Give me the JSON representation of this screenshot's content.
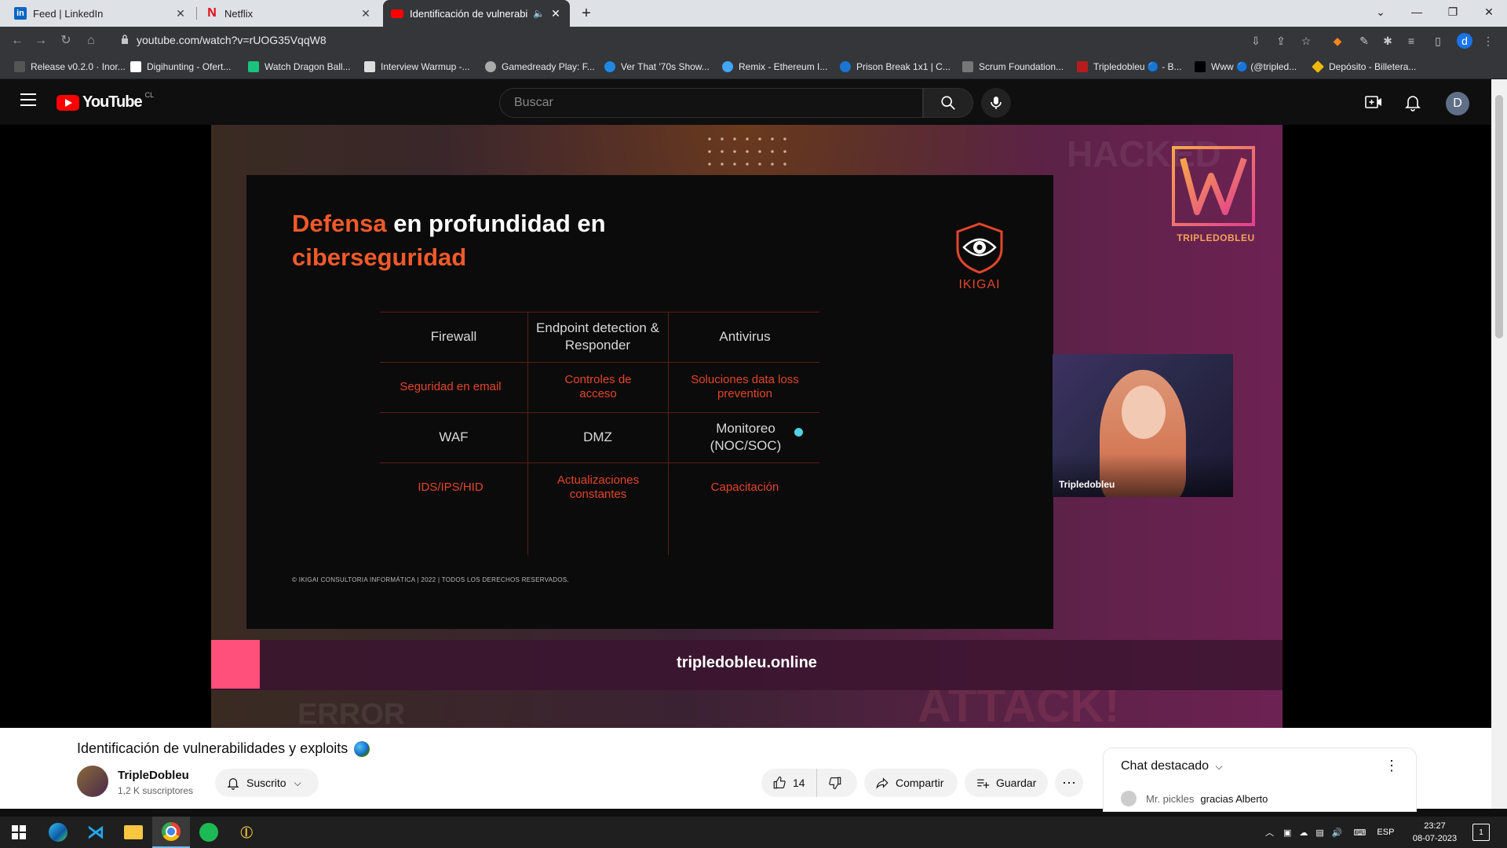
{
  "browser": {
    "tabs": [
      {
        "title": "Feed | LinkedIn",
        "favicon": "linkedin-icon",
        "color": "#0a66c2"
      },
      {
        "title": "Netflix",
        "favicon": "netflix-icon",
        "color": "#e50914"
      },
      {
        "title": "Identificación de vulnerabilidades y exploits",
        "favicon": "youtube-icon",
        "color": "#ff0000",
        "active": true
      }
    ],
    "url": "youtube.com/watch?v=rUOG35VqqW8",
    "bookmarks": [
      {
        "label": "Release v0.2.0 · Inor...",
        "color": "#555"
      },
      {
        "label": "Digihunting - Ofert...",
        "color": "#fff"
      },
      {
        "label": "Watch Dragon Ball...",
        "color": "#19c37d"
      },
      {
        "label": "Interview Warmup -...",
        "color": "#ddd"
      },
      {
        "label": "Gamedready Play: F...",
        "color": "#aaa"
      },
      {
        "label": "Ver That '70s Show...",
        "color": "#1e88e5"
      },
      {
        "label": "Remix - Ethereum I...",
        "color": "#42a5f5"
      },
      {
        "label": "Prison Break 1x1 | C...",
        "color": "#1976d2"
      },
      {
        "label": "Scrum Foundation...",
        "color": "#777"
      },
      {
        "label": "Tripledobleu 🔵 - B...",
        "color": "#b71c1c"
      },
      {
        "label": "Www 🔵 (@tripled...",
        "color": "#000"
      },
      {
        "label": "Depósito - Billetera...",
        "color": "#f0b90b"
      }
    ]
  },
  "youtube": {
    "country": "CL",
    "logo_text": "YouTube",
    "search_placeholder": "Buscar",
    "avatar_letter": "D"
  },
  "slide": {
    "title_highlight": "Defensa",
    "title_rest_line1": " en profundidad en",
    "title_line2": "ciberseguridad",
    "logo_text": "IKIGAI",
    "cells": [
      [
        "Firewall",
        "Endpoint detection & Responder",
        "Antivirus"
      ],
      [
        "Seguridad en email",
        "Controles de acceso",
        "Soluciones data loss prevention"
      ],
      [
        "WAF",
        "DMZ",
        "Monitoreo (NOC/SOC)"
      ],
      [
        "IDS/IPS/HID",
        "Actualizaciones constantes",
        "Capacitación"
      ]
    ],
    "copyright": "© IKIGAI CONSULTORIA INFORMÁTICA | 2022 | TODOS LOS DERECHOS RESERVADOS.",
    "footer_url": "tripledobleu.online",
    "brand": "TRIPLEDOBLEU",
    "webcam_name": "Tripledobleu",
    "bg_words": [
      "HACKED",
      "ERROR",
      "ATTACK!"
    ]
  },
  "video_info": {
    "title": "Identificación de vulnerabilidades y exploits",
    "channel": "TripleDobleu",
    "subscribers": "1,2 K suscriptores",
    "subscribe_label": "Suscrito",
    "likes": "14",
    "share_label": "Compartir",
    "save_label": "Guardar"
  },
  "chat": {
    "title": "Chat destacado",
    "author": "Mr. pickles",
    "message": "gracias Alberto"
  },
  "taskbar": {
    "apps": [
      "windows-start",
      "edge",
      "vscode",
      "file-explorer",
      "chrome",
      "spotify",
      "sentinel"
    ],
    "language": "ESP",
    "time": "23:27",
    "date": "08-07-2023",
    "notifications": "1"
  }
}
